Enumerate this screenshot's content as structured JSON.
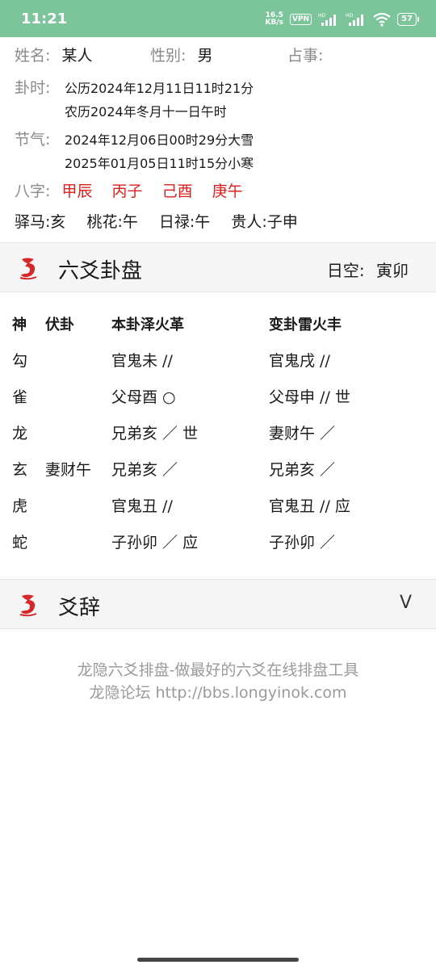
{
  "status_bar": {
    "time": "11:21",
    "speed_top": "16.5",
    "speed_bottom": "KB/s",
    "vpn": "VPN",
    "battery": "57"
  },
  "info": {
    "name_label": "姓名:",
    "name_value": "某人",
    "gender_label": "性别:",
    "gender_value": "男",
    "matter_label": "占事:",
    "time_label": "卦时:",
    "time_line1": "公历2024年12月11日11时21分",
    "time_line2": "农历2024年冬月十一日午时",
    "term_label": "节气:",
    "term_line1": "2024年12月06日00时29分大雪",
    "term_line2": "2025年01月05日11时15分小寒",
    "bazi_label": "八字:",
    "bazi": [
      "甲辰",
      "丙子",
      "己酉",
      "庚午"
    ],
    "extras": [
      "驿马:亥",
      "桃花:午",
      "日禄:午",
      "贵人:子申"
    ]
  },
  "hexagram_section": {
    "title": "六爻卦盘",
    "void_label": "日空:",
    "void_value": "寅卯"
  },
  "table": {
    "headers": [
      "神",
      "伏卦",
      "本卦泽火革",
      "变卦雷火丰"
    ],
    "rows": [
      {
        "spirit": "勾",
        "hidden": "",
        "main": "官鬼未 //",
        "changed": "官鬼戌 //"
      },
      {
        "spirit": "雀",
        "hidden": "",
        "main": "父母酉 ○",
        "changed": "父母申 // 世"
      },
      {
        "spirit": "龙",
        "hidden": "",
        "main": "兄弟亥 ／ 世",
        "changed": "妻财午 ／"
      },
      {
        "spirit": "玄",
        "hidden": "妻财午",
        "main": "兄弟亥 ／",
        "changed": "兄弟亥 ／"
      },
      {
        "spirit": "虎",
        "hidden": "",
        "main": "官鬼丑 //",
        "changed": "官鬼丑 // 应"
      },
      {
        "spirit": "蛇",
        "hidden": "",
        "main": "子孙卯 ／ 应",
        "changed": "子孙卯 ／"
      }
    ]
  },
  "yaoci_section": {
    "title": "爻辞",
    "chevron": "V"
  },
  "footer": {
    "line1": "龙隐六爻排盘-做最好的六爻在线排盘工具",
    "line2": "龙隐论坛 http://bbs.longyinok.com"
  },
  "colors": {
    "status_bar": "#7cc49a",
    "accent_red": "#e01e1e",
    "label_gray": "#8a8a8a",
    "section_bg": "#f5f5f5"
  }
}
